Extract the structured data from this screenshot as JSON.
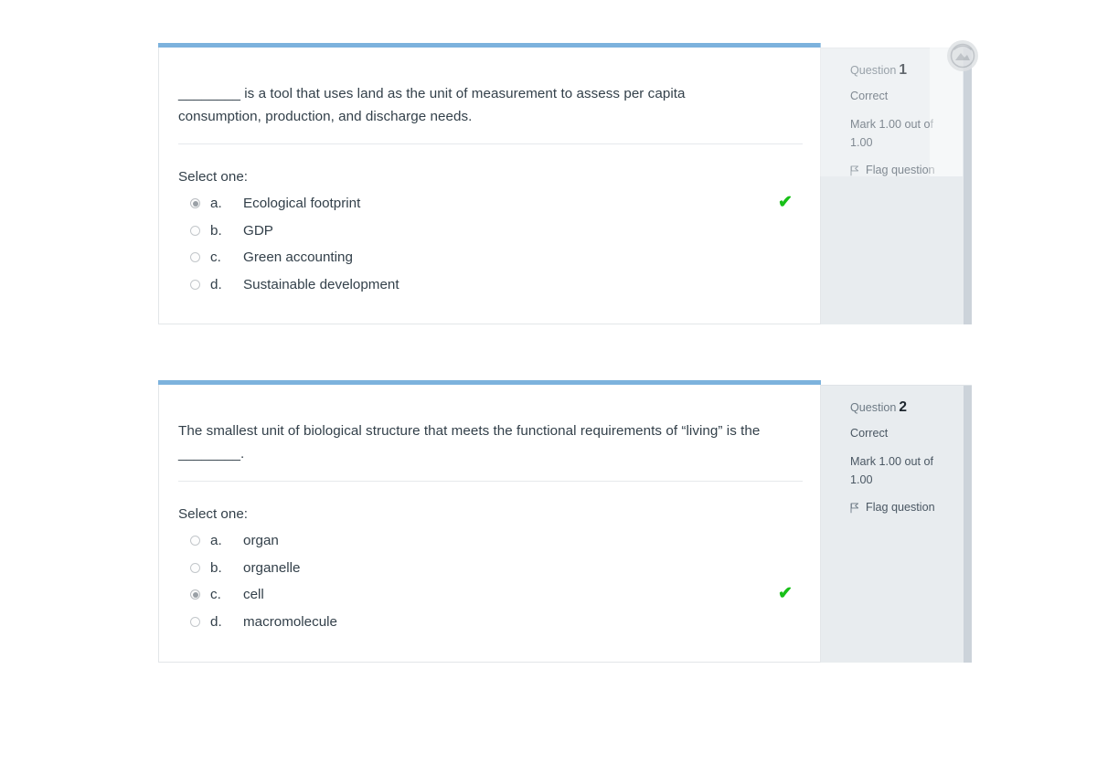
{
  "page": {
    "background_color": "#ffffff",
    "accent_bar_color": "#7cb2dd",
    "sidebar_color": "#e8ecef",
    "correct_color": "#18c018"
  },
  "questions": [
    {
      "text": "________ is a tool that uses land as the unit of measurement to assess per capita consumption, production, and discharge needs.",
      "select_prompt": "Select one:",
      "options": [
        {
          "letter": "a.",
          "label": "Ecological footprint",
          "selected": true,
          "correct_mark": "✔"
        },
        {
          "letter": "b.",
          "label": "GDP",
          "selected": false,
          "correct_mark": ""
        },
        {
          "letter": "c.",
          "label": "Green accounting",
          "selected": false,
          "correct_mark": ""
        },
        {
          "letter": "d.",
          "label": "Sustainable development",
          "selected": false,
          "correct_mark": ""
        }
      ],
      "info": {
        "question_label": "Question",
        "question_number": "1",
        "status": "Correct",
        "mark": "Mark 1.00 out of 1.00",
        "flag_label": "Flag question",
        "flag_icon": "flag-icon"
      }
    },
    {
      "text": "The smallest unit of biological structure that meets the functional requirements of “living” is the ________.",
      "select_prompt": "Select one:",
      "options": [
        {
          "letter": "a.",
          "label": "organ",
          "selected": false,
          "correct_mark": ""
        },
        {
          "letter": "b.",
          "label": "organelle",
          "selected": false,
          "correct_mark": ""
        },
        {
          "letter": "c.",
          "label": "cell",
          "selected": true,
          "correct_mark": "✔"
        },
        {
          "letter": "d.",
          "label": "macromolecule",
          "selected": false,
          "correct_mark": ""
        }
      ],
      "info": {
        "question_label": "Question",
        "question_number": "2",
        "status": "Correct",
        "mark": "Mark 1.00 out of 1.00",
        "flag_label": "Flag question",
        "flag_icon": "flag-icon"
      }
    }
  ],
  "overlay": {
    "badge_icon": "blocked-image-icon"
  }
}
